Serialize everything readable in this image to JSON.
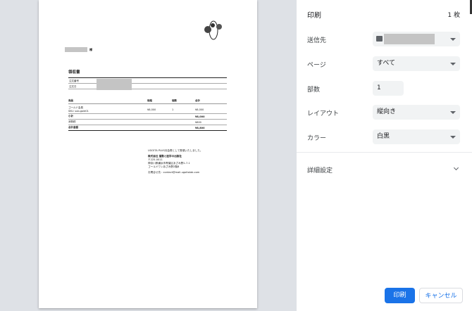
{
  "receipt": {
    "title": "領収書",
    "honorific": "様",
    "info_labels": [
      "注文番号",
      "注文日"
    ],
    "headers": [
      "商品",
      "価格",
      "個数",
      "合計"
    ],
    "item": {
      "name": "ゴールド会員",
      "sku": "SKU: sub-gold01",
      "price": "¥8,000",
      "qty": "1",
      "total": "¥8,000"
    },
    "subtotal_label": "小計",
    "subtotal": "¥8,000",
    "tax_label": "消費税",
    "tax": "¥800",
    "grand_label": "合計金額",
    "grand": "¥8,800",
    "footer": {
      "note": "UGOITA PLUS月会費として受領いたしました。",
      "company": "株式会社 運動と医学の出版社",
      "zip": "〒225-0011",
      "address1": "神奈川県横浜市青葉区あざみ野1-7-1",
      "address2": "ゴールドワンあざみ野2階B",
      "contact": "お問合せ先：contact@mail-ugoitalab.com"
    }
  },
  "panel": {
    "title": "印刷",
    "sheets": "1 枚",
    "destination_label": "送信先",
    "pages_label": "ページ",
    "pages_value": "すべて",
    "copies_label": "部数",
    "copies_value": "1",
    "layout_label": "レイアウト",
    "layout_value": "縦向き",
    "color_label": "カラー",
    "color_value": "白黒",
    "more_settings": "詳細設定",
    "print_button": "印刷",
    "cancel_button": "キャンセル",
    "accent": "#1a73e8"
  }
}
